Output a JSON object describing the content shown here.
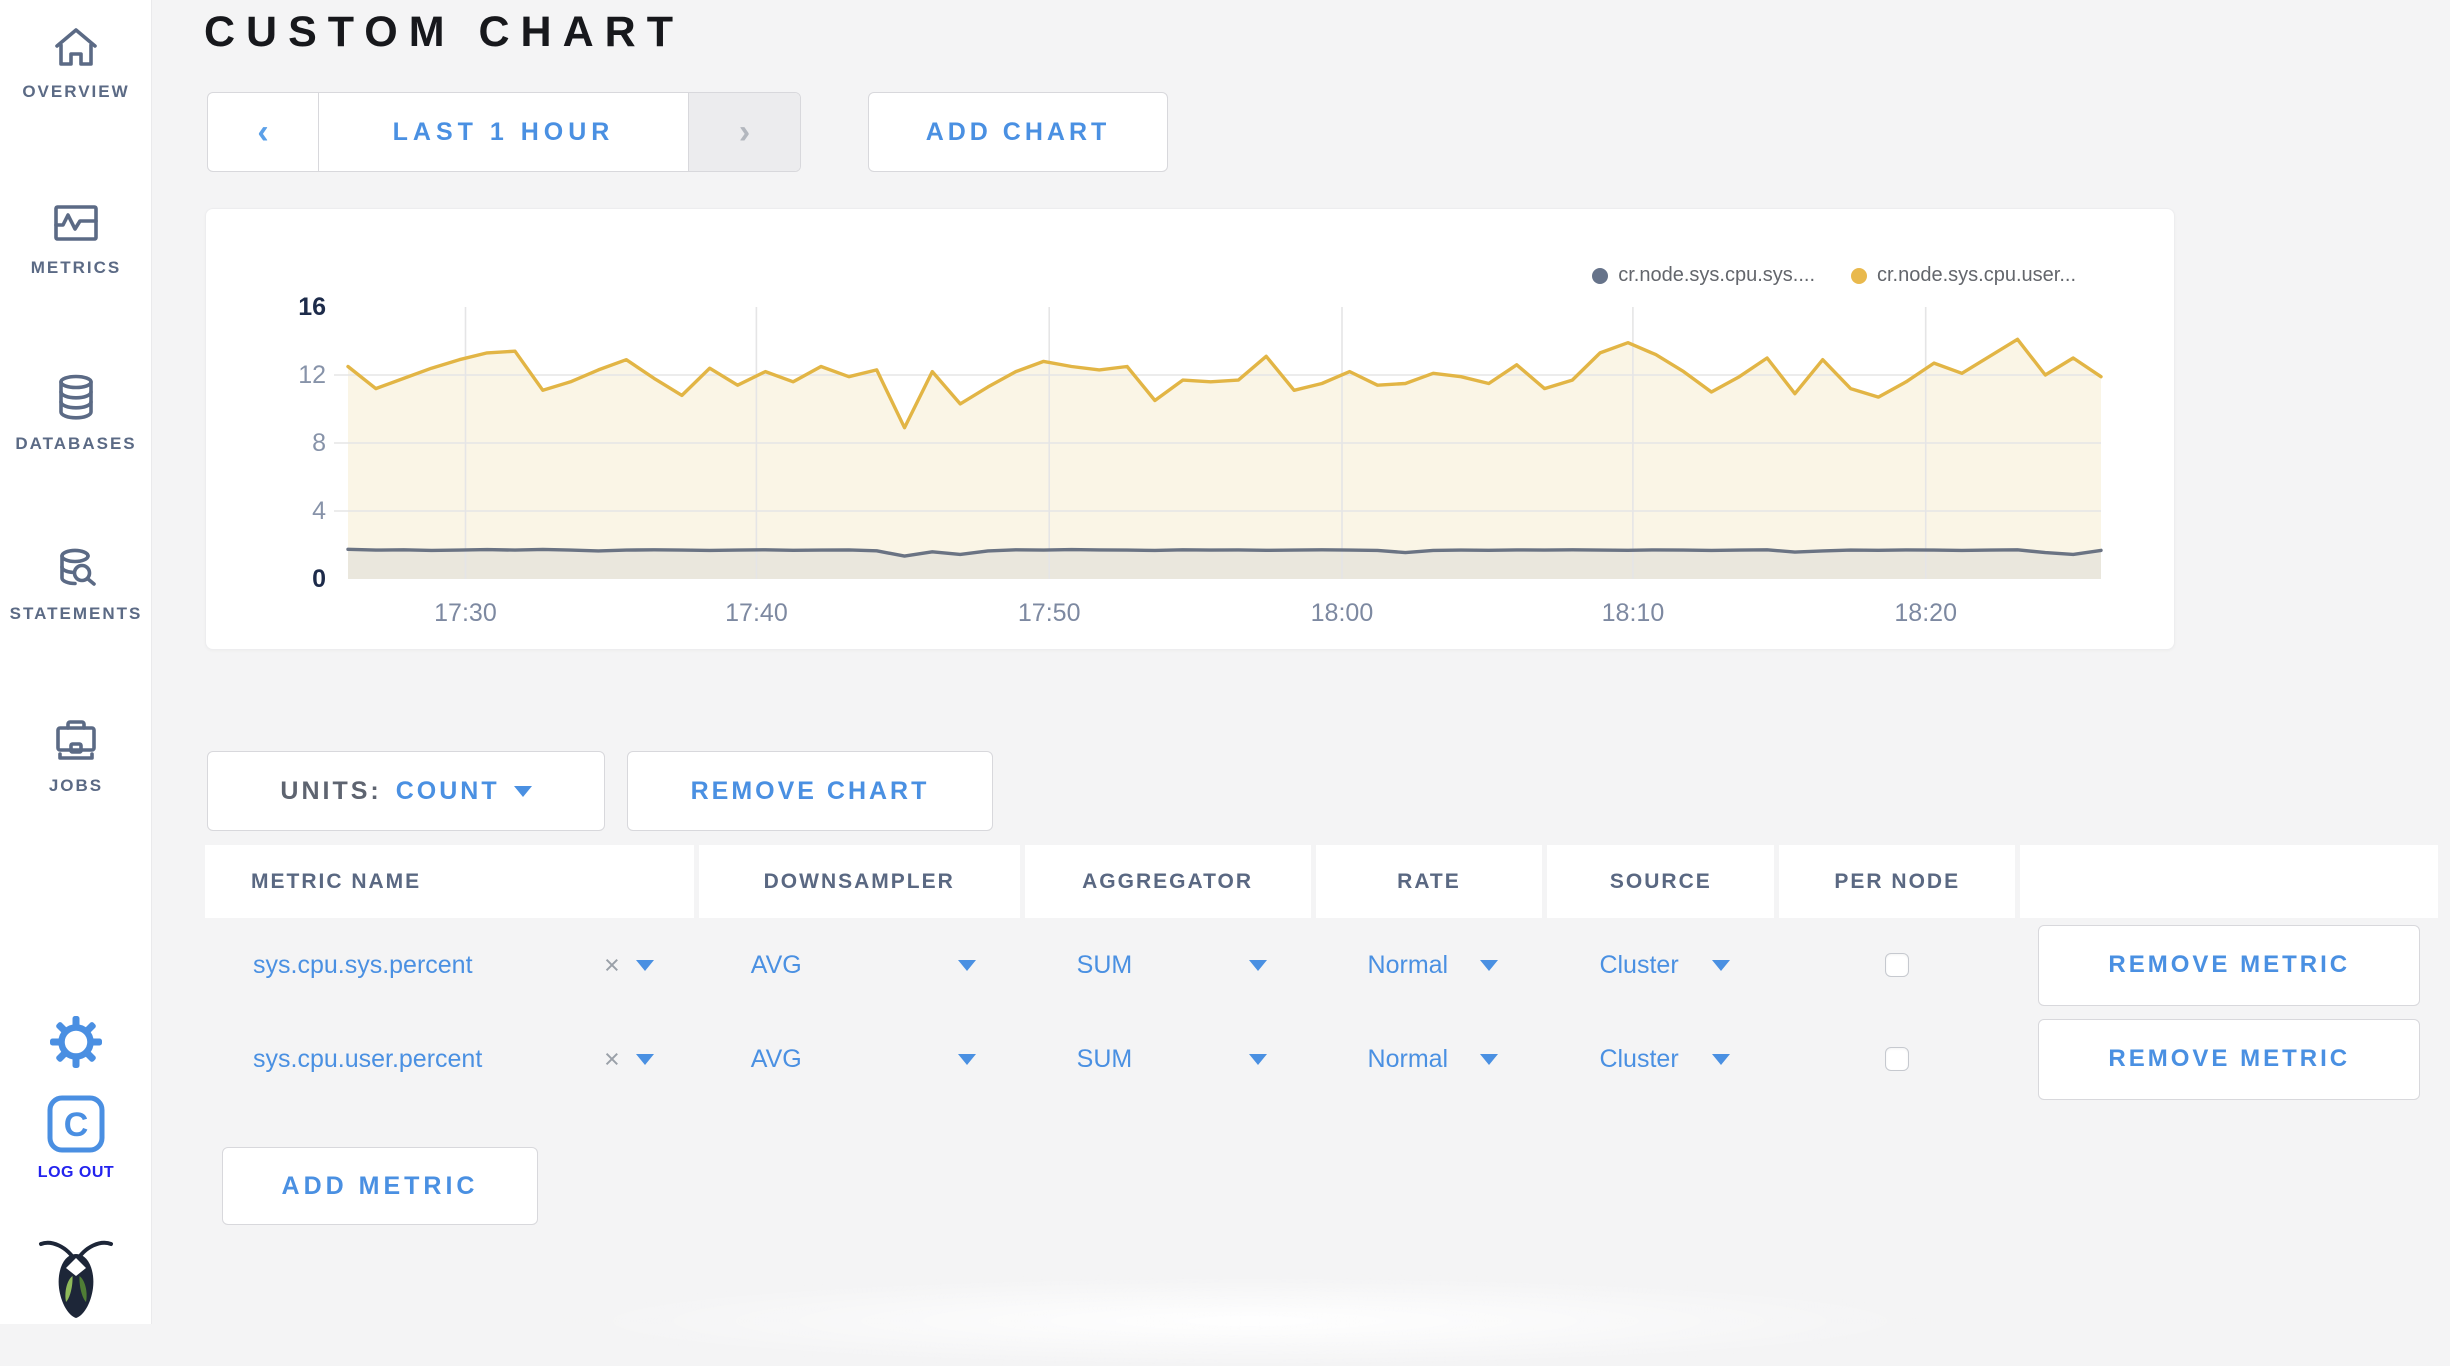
{
  "colors": {
    "accent_blue": "#4a90e2",
    "logout_blue": "#2323ee",
    "sidebar_slate": "#5b6a85",
    "title": "#17181c",
    "series_sys_line": "#6a7383",
    "series_user_line": "#e2b545",
    "fill_user": "#faf5e6",
    "fill_sys": "#eae7dd",
    "grid": "#e5e5e6",
    "axis_label": "#8793a9",
    "axis_label_strong": "#1d2b4a",
    "x_tick_label": "#7d89a1",
    "legend_sys_dot": "#66738a",
    "legend_user_dot": "#e9b94d"
  },
  "sidebar": {
    "items": [
      {
        "label": "OVERVIEW",
        "icon": "home-icon"
      },
      {
        "label": "METRICS",
        "icon": "metrics-icon"
      },
      {
        "label": "DATABASES",
        "icon": "databases-icon"
      },
      {
        "label": "STATEMENTS",
        "icon": "statements-icon"
      },
      {
        "label": "JOBS",
        "icon": "jobs-icon"
      }
    ],
    "logout_label": "LOG OUT"
  },
  "header": {
    "title": "CUSTOM CHART"
  },
  "toolbar": {
    "prev_arrow": "‹",
    "time_range_label": "LAST 1 HOUR",
    "next_arrow": "›",
    "add_chart_label": "ADD CHART"
  },
  "chart_card": {
    "legend": [
      {
        "label": "cr.node.sys.cpu.sys....",
        "color": "#66738a"
      },
      {
        "label": "cr.node.sys.cpu.user...",
        "color": "#e9b94d"
      }
    ]
  },
  "chart_data": {
    "type": "line",
    "title": "",
    "xlabel": "",
    "ylabel": "",
    "ylim": [
      0,
      16
    ],
    "y_ticks": [
      0,
      4,
      8,
      12,
      16
    ],
    "y_gridlines": [
      4,
      8,
      12
    ],
    "x_ticks": [
      "17:30",
      "17:40",
      "17:50",
      "18:00",
      "18:10",
      "18:20"
    ],
    "x_tick_fracs": [
      0.067,
      0.233,
      0.4,
      0.567,
      0.733,
      0.9
    ],
    "grid": true,
    "legend_position": "top-right",
    "series": [
      {
        "name": "cr.node.sys.cpu.sys....",
        "color": "#6a7383",
        "fill": "#eae7dd",
        "values": [
          1.75,
          1.7,
          1.72,
          1.68,
          1.7,
          1.73,
          1.7,
          1.74,
          1.7,
          1.65,
          1.7,
          1.72,
          1.7,
          1.68,
          1.7,
          1.72,
          1.69,
          1.7,
          1.71,
          1.66,
          1.35,
          1.6,
          1.45,
          1.65,
          1.72,
          1.7,
          1.73,
          1.71,
          1.7,
          1.68,
          1.72,
          1.7,
          1.71,
          1.69,
          1.7,
          1.72,
          1.7,
          1.68,
          1.55,
          1.68,
          1.7,
          1.69,
          1.71,
          1.7,
          1.72,
          1.7,
          1.69,
          1.71,
          1.7,
          1.68,
          1.7,
          1.72,
          1.58,
          1.65,
          1.7,
          1.69,
          1.71,
          1.7,
          1.68,
          1.7,
          1.72,
          1.55,
          1.45,
          1.68
        ]
      },
      {
        "name": "cr.node.sys.cpu.user...",
        "color": "#e2b545",
        "fill": "#faf5e6",
        "values": [
          12.5,
          11.2,
          11.8,
          12.4,
          12.9,
          13.3,
          13.4,
          11.1,
          11.6,
          12.3,
          12.9,
          11.8,
          10.8,
          12.4,
          11.4,
          12.2,
          11.6,
          12.5,
          11.9,
          12.3,
          8.9,
          12.2,
          10.3,
          11.3,
          12.2,
          12.8,
          12.5,
          12.3,
          12.5,
          10.5,
          11.7,
          11.6,
          11.7,
          13.1,
          11.1,
          11.5,
          12.2,
          11.4,
          11.5,
          12.1,
          11.9,
          11.5,
          12.6,
          11.2,
          11.7,
          13.3,
          13.9,
          13.2,
          12.2,
          11.0,
          11.9,
          13.0,
          10.9,
          12.9,
          11.2,
          10.7,
          11.6,
          12.7,
          12.1,
          13.1,
          14.1,
          12.0,
          13.0,
          11.9
        ]
      }
    ]
  },
  "units_control": {
    "label": "UNITS:",
    "value": "COUNT"
  },
  "remove_chart_label": "REMOVE CHART",
  "metrics_table": {
    "columns": [
      "METRIC NAME",
      "DOWNSAMPLER",
      "AGGREGATOR",
      "RATE",
      "SOURCE",
      "PER NODE",
      ""
    ],
    "rows": [
      {
        "metric_name": "sys.cpu.sys.percent",
        "clear": "×",
        "downsampler": "AVG",
        "aggregator": "SUM",
        "rate": "Normal",
        "source": "Cluster",
        "per_node_checked": false,
        "remove_label": "REMOVE METRIC"
      },
      {
        "metric_name": "sys.cpu.user.percent",
        "clear": "×",
        "downsampler": "AVG",
        "aggregator": "SUM",
        "rate": "Normal",
        "source": "Cluster",
        "per_node_checked": false,
        "remove_label": "REMOVE METRIC"
      }
    ]
  },
  "add_metric_label": "ADD METRIC"
}
